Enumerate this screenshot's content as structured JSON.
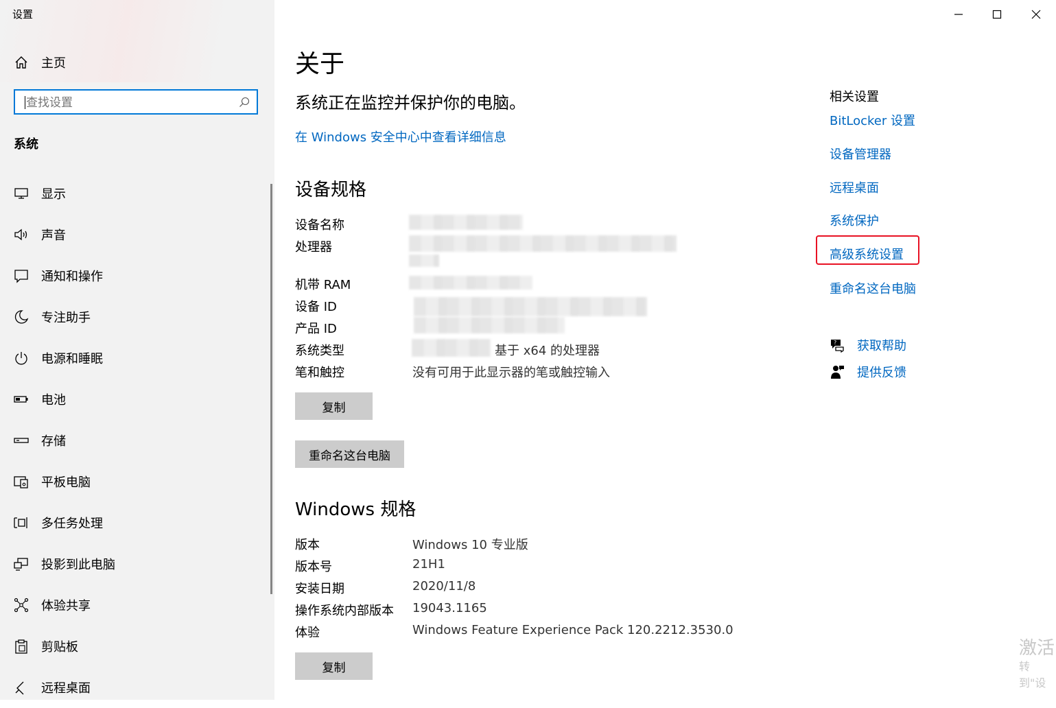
{
  "window": {
    "title": "设置"
  },
  "sidebar": {
    "home_label": "主页",
    "search_placeholder": "查找设置",
    "section_title": "系统",
    "items": [
      {
        "label": "显示",
        "icon": "monitor-icon"
      },
      {
        "label": "声音",
        "icon": "speaker-icon"
      },
      {
        "label": "通知和操作",
        "icon": "notification-icon"
      },
      {
        "label": "专注助手",
        "icon": "moon-icon"
      },
      {
        "label": "电源和睡眠",
        "icon": "power-icon"
      },
      {
        "label": "电池",
        "icon": "battery-icon"
      },
      {
        "label": "存储",
        "icon": "storage-icon"
      },
      {
        "label": "平板电脑",
        "icon": "tablet-icon"
      },
      {
        "label": "多任务处理",
        "icon": "multitask-icon"
      },
      {
        "label": "投影到此电脑",
        "icon": "project-icon"
      },
      {
        "label": "体验共享",
        "icon": "share-icon"
      },
      {
        "label": "剪贴板",
        "icon": "clipboard-icon"
      },
      {
        "label": "远程桌面",
        "icon": "remote-desktop-icon"
      }
    ]
  },
  "main": {
    "title": "关于",
    "protect_text": "系统正在监控并保护你的电脑。",
    "security_link": "在 Windows 安全中心中查看详细信息",
    "device_specs": {
      "heading": "设备规格",
      "rows": [
        {
          "label": "设备名称",
          "value": ""
        },
        {
          "label": "处理器",
          "value": ""
        },
        {
          "label": "机带 RAM",
          "value": ""
        },
        {
          "label": "设备 ID",
          "value": ""
        },
        {
          "label": "产品 ID",
          "value": ""
        },
        {
          "label": "系统类型",
          "value": "基于 x64 的处理器"
        },
        {
          "label": "笔和触控",
          "value": "没有可用于此显示器的笔或触控输入"
        }
      ],
      "copy_button": "复制",
      "rename_button": "重命名这台电脑"
    },
    "windows_specs": {
      "heading": "Windows 规格",
      "rows": [
        {
          "label": "版本",
          "value": "Windows 10 专业版"
        },
        {
          "label": "版本号",
          "value": "21H1"
        },
        {
          "label": "安装日期",
          "value": "2020/11/8"
        },
        {
          "label": "操作系统内部版本",
          "value": "19043.1165"
        },
        {
          "label": "体验",
          "value": "Windows Feature Experience Pack 120.2212.3530.0"
        }
      ],
      "copy_button": "复制"
    }
  },
  "related": {
    "title": "相关设置",
    "links": [
      "BitLocker 设置",
      "设备管理器",
      "远程桌面",
      "系统保护",
      "高级系统设置",
      "重命名这台电脑"
    ],
    "help": "获取帮助",
    "feedback": "提供反馈"
  },
  "watermark": {
    "line1": "激活",
    "line2": "转到\"设"
  },
  "colors": {
    "accent": "#0078d7",
    "link": "#0067c0",
    "highlight": "#e81123",
    "sidebar_bg": "#f2f2f2"
  }
}
